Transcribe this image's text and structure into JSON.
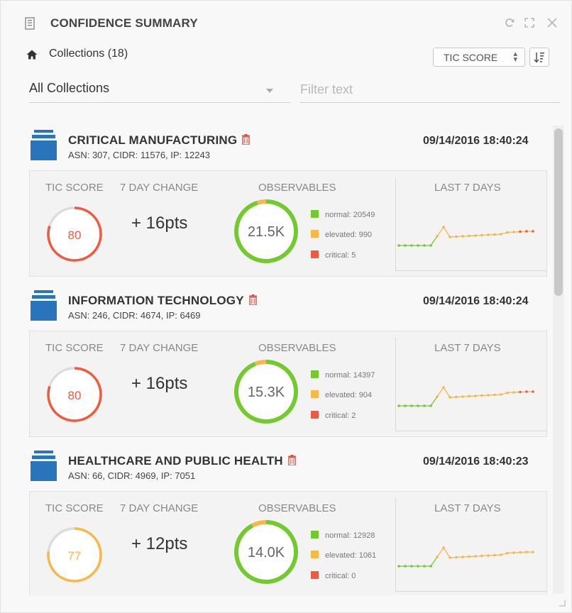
{
  "header": {
    "title": "CONFIDENCE SUMMARY",
    "icons": [
      "document-icon",
      "refresh-icon",
      "maximize-icon",
      "close-icon"
    ]
  },
  "toolbar": {
    "collections_label": "Collections (18)",
    "score_select": "TIC SCORE",
    "sort_icon": "sort-icon"
  },
  "filters": {
    "collection_dropdown": "All Collections",
    "filter_placeholder": "Filter text"
  },
  "labels": {
    "tic_score": "TIC SCORE",
    "change": "7 DAY CHANGE",
    "observables": "OBSERVABLES",
    "last7": "LAST 7 DAYS"
  },
  "colors": {
    "normal": "#73c92d",
    "elevated": "#f7b84a",
    "critical": "#f05a3f",
    "spark_line": "#f6b54a",
    "icon_blue": "#2a74bb",
    "trash_red": "#e74c3c"
  },
  "collections": [
    {
      "name": "CRITICAL MANUFACTURING",
      "meta": "ASN: 307, CIDR: 11576, IP: 12243",
      "timestamp": "09/14/2016 18:40:24",
      "tic_score": "80",
      "score_level": "critical",
      "score_fraction": 0.8,
      "change": "+ 16pts",
      "observables_total": "21.5K",
      "normal": "normal: 20549",
      "elevated": "elevated: 990",
      "critical": "critical: 5",
      "counts": [
        20549,
        990,
        5
      ]
    },
    {
      "name": "INFORMATION TECHNOLOGY",
      "meta": "ASN: 246, CIDR: 4674, IP: 6469",
      "timestamp": "09/14/2016 18:40:24",
      "tic_score": "80",
      "score_level": "critical",
      "score_fraction": 0.8,
      "change": "+ 16pts",
      "observables_total": "15.3K",
      "normal": "normal: 14397",
      "elevated": "elevated: 904",
      "critical": "critical: 2",
      "counts": [
        14397,
        904,
        2
      ]
    },
    {
      "name": "HEALTHCARE AND PUBLIC HEALTH",
      "meta": "ASN: 66, CIDR: 4969, IP: 7051",
      "timestamp": "09/14/2016 18:40:23",
      "tic_score": "77",
      "score_level": "elevated",
      "score_fraction": 0.77,
      "change": "+ 12pts",
      "observables_total": "14.0K",
      "normal": "normal: 12928",
      "elevated": "elevated: 1061",
      "critical": "critical: 0",
      "counts": [
        12928,
        1061,
        0
      ]
    }
  ]
}
